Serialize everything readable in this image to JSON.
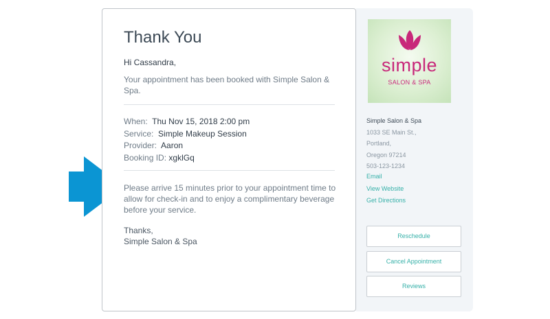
{
  "colors": {
    "accent": "#35b0a8",
    "arrow": "#0b95d3",
    "brand": "#c8287a"
  },
  "confirmation": {
    "title": "Thank You",
    "greeting": "Hi Cassandra,",
    "intro": "Your appointment has been booked with Simple Salon & Spa.",
    "details": [
      {
        "label": "When:",
        "value": "Thu Nov 15, 2018 2:00 pm"
      },
      {
        "label": "Service:",
        "value": "Simple Makeup Session"
      },
      {
        "label": "Provider:",
        "value": "Aaron"
      },
      {
        "label": "Booking ID:",
        "value": "xgklGq"
      }
    ],
    "note": "Please arrive 15 minutes prior to your appointment time to allow for check-in and to enjoy a complimentary beverage before your service.",
    "signoff": "Thanks,",
    "signature": "Simple Salon & Spa"
  },
  "sidebar": {
    "logo": {
      "word": "simple",
      "sub": "SALON & SPA",
      "icon": "lotus-icon"
    },
    "business_name": "Simple Salon & Spa",
    "address_line1": "1033 SE Main St.,",
    "city": "Portland,",
    "state_zip": "Oregon 97214",
    "phone": "503-123-1234",
    "links": {
      "email": "Email",
      "website": "View Website",
      "directions": "Get Directions"
    },
    "buttons": {
      "reschedule": "Reschedule",
      "cancel": "Cancel Appointment",
      "reviews": "Reviews"
    }
  }
}
